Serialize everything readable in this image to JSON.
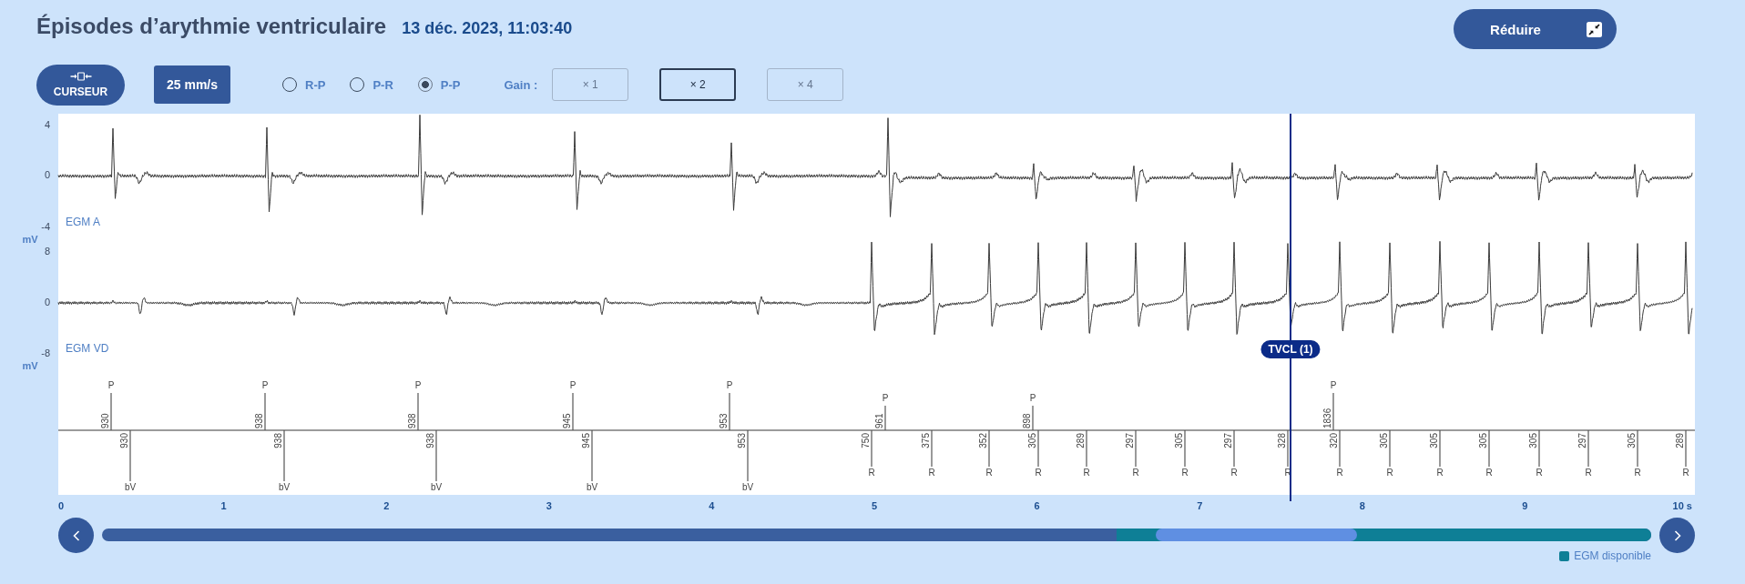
{
  "header": {
    "title": "Épisodes d’arythmie ventriculaire",
    "timestamp": "13 déc. 2023, 11:03:40",
    "collapse_button": {
      "label": "Réduire"
    }
  },
  "toolbar": {
    "cursor_button": {
      "label": "CURSEUR"
    },
    "speed_button": {
      "label": "25 mm/s"
    },
    "interval_options": [
      {
        "label": "R-P",
        "selected": false
      },
      {
        "label": "P-R",
        "selected": false
      },
      {
        "label": "P-P",
        "selected": true
      }
    ],
    "gain_label": "Gain :",
    "gain_options": [
      {
        "label": "× 1",
        "selected": false,
        "disabled": true
      },
      {
        "label": "× 2",
        "selected": true,
        "disabled": false
      },
      {
        "label": "× 4",
        "selected": false,
        "disabled": true
      }
    ]
  },
  "channels": [
    {
      "name": "EGM A",
      "unit": "mV",
      "ticks": [
        "4",
        "0",
        "-4"
      ]
    },
    {
      "name": "EGM VD",
      "unit": "mV",
      "ticks": [
        "8",
        "0",
        "-8"
      ]
    }
  ],
  "marker_channel": {
    "atrial": [
      {
        "letter": "P",
        "interval": "930",
        "kind": "long"
      },
      {
        "letter": "P",
        "interval": "938",
        "kind": "long"
      },
      {
        "letter": "P",
        "interval": "938",
        "kind": "long"
      },
      {
        "letter": "P",
        "interval": "945",
        "kind": "long"
      },
      {
        "letter": "P",
        "interval": "953",
        "kind": "long"
      },
      {
        "letter": "P",
        "interval": "961",
        "kind": "short"
      },
      {
        "letter": "P",
        "interval": "898",
        "kind": "short"
      },
      {
        "letter": "P",
        "interval": "1836",
        "kind": "long"
      }
    ],
    "ventricular": [
      {
        "letter": "bV",
        "interval": "930",
        "kind": "long"
      },
      {
        "letter": "bV",
        "interval": "938",
        "kind": "long"
      },
      {
        "letter": "bV",
        "interval": "938",
        "kind": "long"
      },
      {
        "letter": "bV",
        "interval": "945",
        "kind": "long"
      },
      {
        "letter": "bV",
        "interval": "953",
        "kind": "long"
      },
      {
        "letter": "R",
        "interval": "750",
        "kind": "short"
      },
      {
        "letter": "R",
        "interval": "375",
        "kind": "short"
      },
      {
        "letter": "R",
        "interval": "352",
        "kind": "short"
      },
      {
        "letter": "R",
        "interval": "305",
        "kind": "short"
      },
      {
        "letter": "R",
        "interval": "289",
        "kind": "short"
      },
      {
        "letter": "R",
        "interval": "297",
        "kind": "short"
      },
      {
        "letter": "R",
        "interval": "305",
        "kind": "short"
      },
      {
        "letter": "R",
        "interval": "297",
        "kind": "short"
      },
      {
        "letter": "R",
        "interval": "328",
        "kind": "short"
      },
      {
        "letter": "R",
        "interval": "320",
        "kind": "short"
      },
      {
        "letter": "R",
        "interval": "305",
        "kind": "short"
      },
      {
        "letter": "R",
        "interval": "305",
        "kind": "short"
      },
      {
        "letter": "R",
        "interval": "305",
        "kind": "short"
      },
      {
        "letter": "R",
        "interval": "305",
        "kind": "short"
      },
      {
        "letter": "R",
        "interval": "297",
        "kind": "short"
      },
      {
        "letter": "R",
        "interval": "305",
        "kind": "short"
      },
      {
        "letter": "R",
        "interval": "289",
        "kind": "short"
      }
    ]
  },
  "cursor": {
    "label": "TVCL (1)"
  },
  "time_axis": {
    "ticks": [
      "0",
      "1",
      "2",
      "3",
      "4",
      "5",
      "6",
      "7",
      "8",
      "9",
      "10 s"
    ]
  },
  "timeline": {
    "legend": [
      {
        "label": "EGM disponible",
        "color": "#0e7f96"
      }
    ]
  }
}
